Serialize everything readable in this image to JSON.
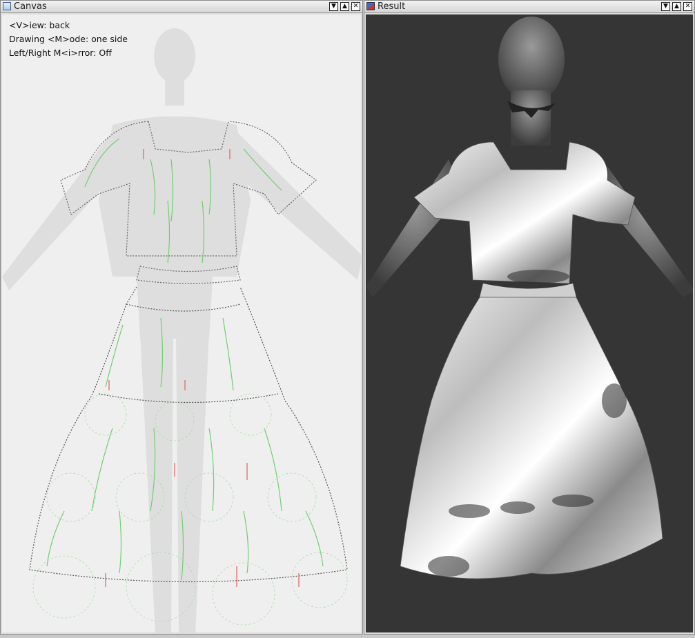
{
  "windows": {
    "canvas": {
      "title": "Canvas",
      "status_lines": [
        "<V>iew: back",
        "Drawing <M>ode: one side",
        "Left/Right M<i>rror: Off"
      ]
    },
    "result": {
      "title": "Result"
    }
  },
  "titlebar_buttons": [
    "▼",
    "▲",
    "✕"
  ],
  "colors": {
    "canvas_background": "#efefef",
    "result_background": "#353535",
    "stroke_green": "#6fcf6f",
    "stroke_red": "#e06060",
    "outline_gray": "#666666"
  }
}
